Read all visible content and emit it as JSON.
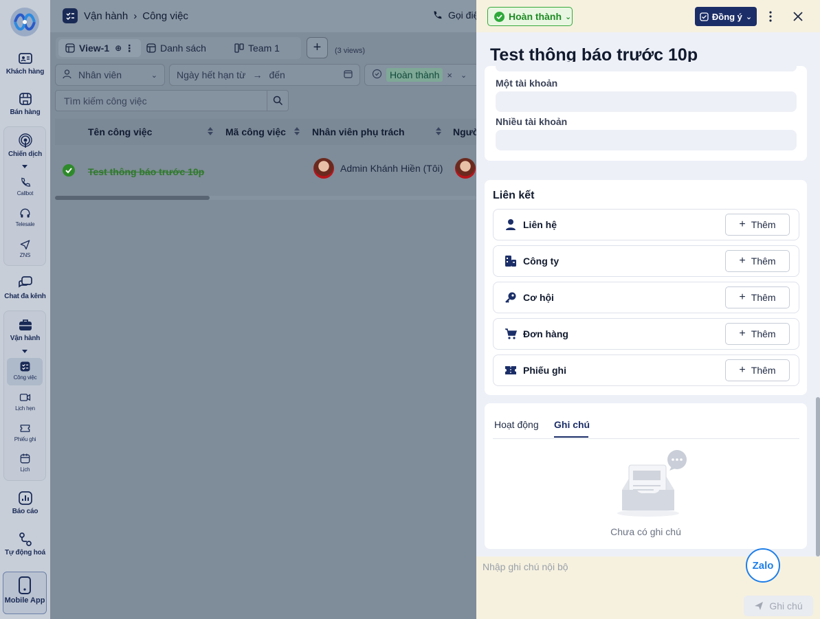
{
  "rail": {
    "items": [
      {
        "label": "Khách hàng"
      },
      {
        "label": "Bán hàng"
      },
      {
        "label": "Chiến dịch"
      },
      {
        "label": "Callbot"
      },
      {
        "label": "Telesale"
      },
      {
        "label": "ZNS"
      },
      {
        "label": "Chat đa kênh"
      },
      {
        "label": "Vận hành"
      },
      {
        "label": "Công việc"
      },
      {
        "label": "Lịch hẹn"
      },
      {
        "label": "Phiếu ghi"
      },
      {
        "label": "Lịch"
      },
      {
        "label": "Báo cáo"
      },
      {
        "label": "Tự động hoá"
      }
    ],
    "mobile_app": "Mobile App"
  },
  "header": {
    "crumb_parent": "Vận hành",
    "crumb_current": "Công việc",
    "call_label": "Gọi điệ"
  },
  "views": {
    "tabs": [
      {
        "label": "View-1"
      },
      {
        "label": "Danh sách"
      },
      {
        "label": "Team 1"
      }
    ],
    "count": "(3 views)"
  },
  "filters": {
    "employee_placeholder": "Nhân viên",
    "date_from": "Ngày hết hạn từ",
    "date_arrow": "→",
    "date_to": "đến",
    "status_chip": "Hoàn thành"
  },
  "search": {
    "placeholder": "Tìm kiếm công việc"
  },
  "table": {
    "columns": [
      "Tên công việc",
      "Mã công việc",
      "Nhân viên phụ trách",
      "Người"
    ],
    "rows": [
      {
        "name": "Test thông báo trước 10p",
        "assignee": "Admin Khánh Hiền (Tôi)"
      }
    ]
  },
  "drawer": {
    "status": "Hoàn thành",
    "agree": "Đồng ý",
    "title": "Test thông báo trước 10p",
    "fields": [
      {
        "label": "Một tài khoản"
      },
      {
        "label": "Nhiều tài khoản"
      }
    ],
    "links_title": "Liên kết",
    "links": [
      {
        "label": "Liên hệ",
        "add": "Thêm"
      },
      {
        "label": "Công ty",
        "add": "Thêm"
      },
      {
        "label": "Cơ hội",
        "add": "Thêm"
      },
      {
        "label": "Đơn hàng",
        "add": "Thêm"
      },
      {
        "label": "Phiếu ghi",
        "add": "Thêm"
      }
    ],
    "activity_tabs": [
      {
        "label": "Hoạt động"
      },
      {
        "label": "Ghi chú"
      }
    ],
    "empty_note": "Chưa có ghi chú",
    "note_placeholder": "Nhập ghi chú nội bộ",
    "zalo": "Zalo",
    "send": "Ghi chú"
  },
  "colors": {
    "primary": "#1b2e68",
    "success": "#2ea93a",
    "drawer_header": "#f6f1df"
  }
}
